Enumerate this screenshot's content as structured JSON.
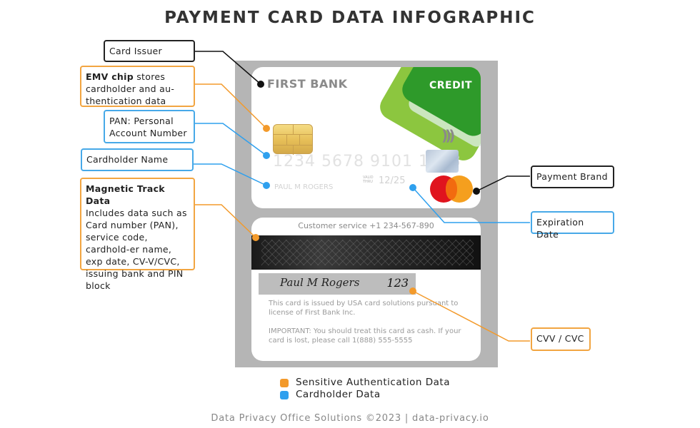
{
  "title": "PAYMENT CARD DATA INFOGRAPHIC",
  "colors": {
    "sensitive": "#f39a2b",
    "cardholder": "#2fa0ee",
    "neutral": "#111111",
    "credit_green": "#2e9a2a"
  },
  "callouts": {
    "card_issuer": "Card Issuer",
    "emv_bold": "EMV chip",
    "emv_text": " stores cardholder and au-thentication data",
    "pan": "PAN: Personal Account Number",
    "cardholder_name": "Cardholder Name",
    "magnetic_bold": "Magnetic Track Data",
    "magnetic_text": "Includes data such as Card number (PAN), service code, cardhold-er name, exp date, CV-V/CVC, issuing bank and PIN block",
    "payment_brand": "Payment Brand",
    "expiration_date": "Expiration Date",
    "cvv": "CVV / CVC"
  },
  "card_front": {
    "bank_name": "FIRST BANK",
    "type_label": "CREDIT",
    "pan": "1234 5678 9101 1123",
    "holder_name": "PAUL M ROGERS",
    "valid_label": "VALID THRU",
    "expiry": "12/25",
    "contactless_icon": "contactless-icon",
    "brand_icon": "mastercard-logo"
  },
  "card_back": {
    "customer_service": "Customer service +1 234-567-890",
    "signature": "Paul M Rogers",
    "cvv": "123",
    "issue_text": "This card is issued by USA card solutions pursuant to license of First Bank Inc.",
    "important_text": "IMPORTANT: You should treat this card as cash. If your card is lost, please call 1(888) 555-5555"
  },
  "legend": [
    {
      "label": "Sensitive Authentication Data",
      "color": "#f39a2b"
    },
    {
      "label": "Cardholder Data",
      "color": "#2fa0ee"
    }
  ],
  "footer": "Data Privacy Office Solutions ©2023 | data-privacy.io"
}
